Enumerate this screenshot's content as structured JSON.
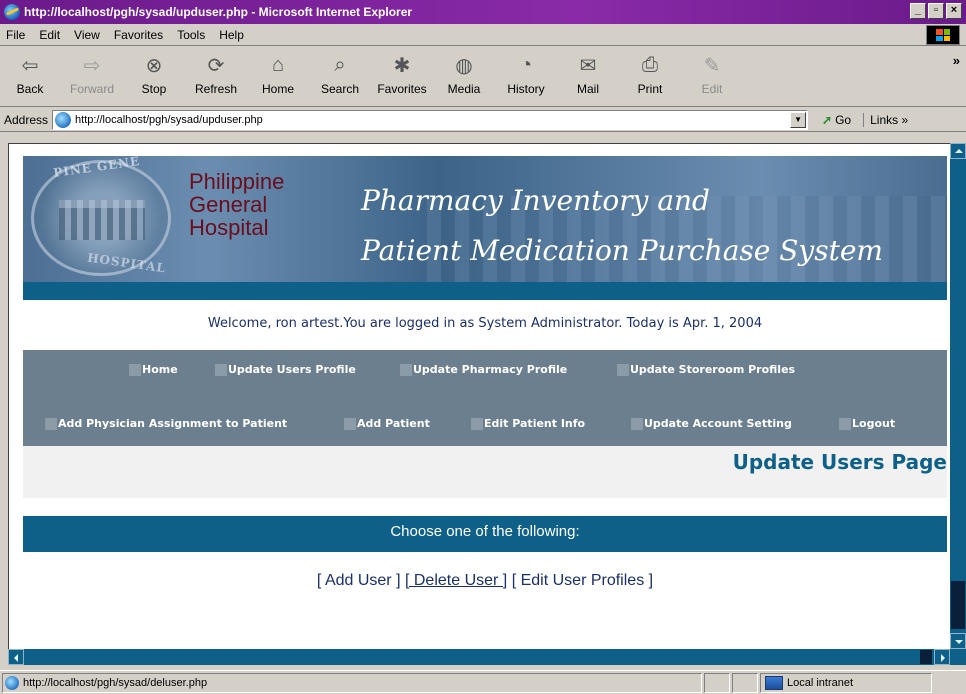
{
  "window": {
    "title": "http://localhost/pgh/sysad/upduser.php - Microsoft Internet Explorer",
    "buttons": {
      "minimize": "_",
      "maximize": "▫",
      "close": "×"
    }
  },
  "menu": [
    "File",
    "Edit",
    "View",
    "Favorites",
    "Tools",
    "Help"
  ],
  "toolbar": {
    "buttons": [
      {
        "label": "Back",
        "icon": "back-arrow-icon",
        "glyph": "⇦",
        "enabled": true,
        "dropdown": true
      },
      {
        "label": "Forward",
        "icon": "forward-arrow-icon",
        "glyph": "⇨",
        "enabled": false,
        "dropdown": true
      },
      {
        "label": "Stop",
        "icon": "stop-icon",
        "glyph": "⊗",
        "enabled": true
      },
      {
        "label": "Refresh",
        "icon": "refresh-icon",
        "glyph": "⟳",
        "enabled": true
      },
      {
        "label": "Home",
        "icon": "home-icon",
        "glyph": "⌂",
        "enabled": true
      },
      {
        "label": "Search",
        "icon": "search-icon",
        "glyph": "⌕",
        "enabled": true
      },
      {
        "label": "Favorites",
        "icon": "favorites-icon",
        "glyph": "✱",
        "enabled": true
      },
      {
        "label": "Media",
        "icon": "media-icon",
        "glyph": "◍",
        "enabled": true
      },
      {
        "label": "History",
        "icon": "history-icon",
        "glyph": "◔",
        "enabled": true
      },
      {
        "label": "Mail",
        "icon": "mail-icon",
        "glyph": "✉",
        "enabled": true,
        "dropdown": true
      },
      {
        "label": "Print",
        "icon": "print-icon",
        "glyph": "⎙",
        "enabled": true
      },
      {
        "label": "Edit",
        "icon": "edit-icon",
        "glyph": "✎",
        "enabled": false
      }
    ],
    "more": "»"
  },
  "address": {
    "label": "Address",
    "url": "http://localhost/pgh/sysad/upduser.php",
    "go": "Go",
    "links": "Links »"
  },
  "page": {
    "hospital_name": [
      "Philippine",
      "General",
      "Hospital"
    ],
    "seal_top": "PINE GENE",
    "seal_bottom": "HOSPITAL",
    "system_title_line1": "Pharmacy Inventory and",
    "system_title_line2": "Patient Medication Purchase System",
    "welcome": "Welcome, ron  artest.You are logged in as System Administrator. Today is Apr. 1, 2004",
    "nav_row1": [
      "Home",
      "Update Users Profile",
      "Update Pharmacy Profile",
      "Update Storeroom Profiles"
    ],
    "nav_row2": [
      "Add Physician Assignment to Patient",
      "Add Patient",
      "Edit Patient Info",
      "Update Account Setting",
      "Logout"
    ],
    "page_title": "Update Users Page",
    "choose_prompt": "Choose one of the following:",
    "actions": {
      "open1": "[ ",
      "add_user": "Add User",
      "sep1": " ] ",
      "delete_user": "[ Delete User ]",
      "sep2": " [ ",
      "edit_profiles": "Edit User Profiles",
      "close": " ]"
    }
  },
  "status": {
    "text": "http://localhost/pgh/sysad/deluser.php",
    "zone": "Local intranet"
  },
  "colors": {
    "title_bar": "#6a1a8a",
    "banner_blue": "#0e6089",
    "nav_bg": "#6b7f8f",
    "hospital_name": "#6a0e1e",
    "welcome_text": "#1b2f6b"
  }
}
